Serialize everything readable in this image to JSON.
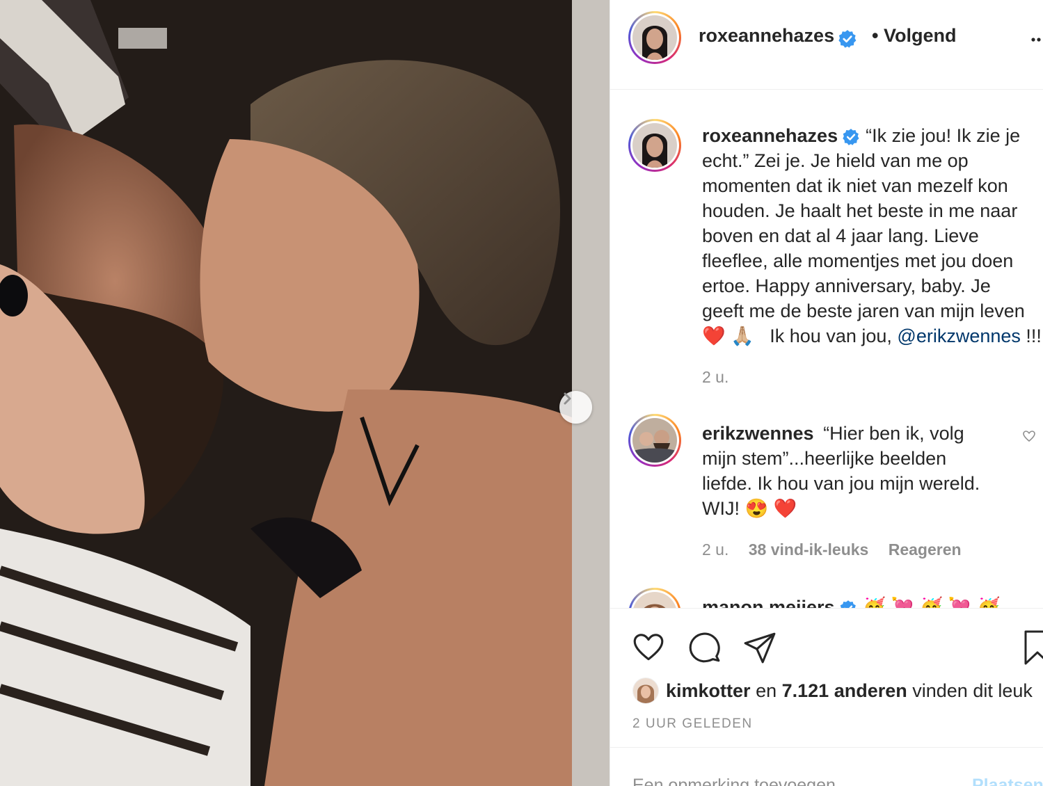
{
  "post": {
    "author": "roxeannehazes",
    "follow_status": "• Volgend",
    "more_label": "•••"
  },
  "caption": {
    "username": "roxeannehazes",
    "lines": [
      "“Ik zie jou! Ik zie je",
      "echt.” Zei je. Je hield van me op",
      "momenten dat ik niet van mezelf kon",
      "houden. Je haalt het beste in me naar",
      "boven en dat al 4 jaar lang. Lieve",
      "fleeflee, alle momentjes met jou doen",
      "ertoe. Happy anniversary, baby. Je",
      "geeft me de beste jaren van mijn leven"
    ],
    "last_line_emoji": "❤️ 🙏🏼",
    "last_line_text": "Ik hou van jou,",
    "mention": "@erikzwennes",
    "tail": "!!!",
    "time": "2 u."
  },
  "comments": [
    {
      "username": "erikzwennes",
      "lines": [
        "“Hier ben ik, volg",
        "mijn stem”...heerlijke beelden",
        "liefde. Ik hou van jou mijn wereld.",
        "WIJ! 😍 ❤️"
      ],
      "time": "2 u.",
      "likes": "38 vind-ik-leuks",
      "reply": "Reageren"
    },
    {
      "username": "manon meijers",
      "text": "🥳 💘 🥳 💘 🥳"
    }
  ],
  "likes_bar": {
    "liker": "kimkotter",
    "connector": "en",
    "count": "7.121 anderen",
    "suffix": "vinden dit leuk"
  },
  "timestamp": "2 UUR GELEDEN",
  "add_comment": {
    "placeholder": "Een opmerking toevoegen...",
    "post_label": "Plaatsen"
  },
  "colors": {
    "verified": "#3897f0",
    "mention": "#00376b",
    "muted": "#8e8e8e"
  }
}
